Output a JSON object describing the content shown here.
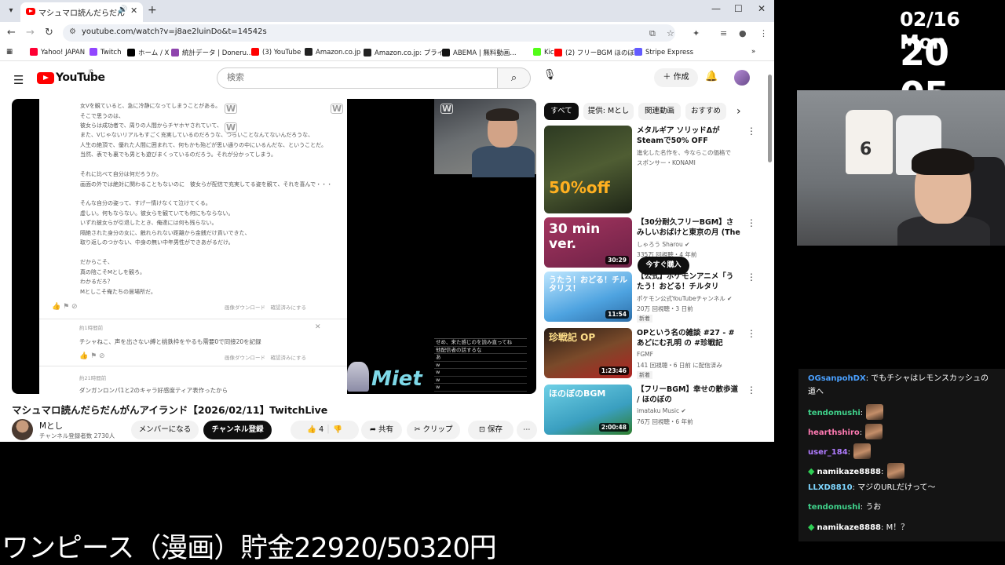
{
  "browser": {
    "tab_title": "マシュマロ読んだらだんがんアイ",
    "url": "youtube.com/watch?v=j8ae2luinDo&t=14542s",
    "bookmarks": [
      {
        "label": "Yahoo! JAPAN",
        "color": "#ff0033"
      },
      {
        "label": "Twitch",
        "color": "#9146ff"
      },
      {
        "label": "ホーム / X",
        "color": "#000000"
      },
      {
        "label": "統計データ | Doneru...",
        "color": "#8e44ad"
      },
      {
        "label": "(3) YouTube",
        "color": "#ff0000"
      },
      {
        "label": "Amazon.co.jp",
        "color": "#222222"
      },
      {
        "label": "Amazon.co.jp: プライ...",
        "color": "#222222"
      },
      {
        "label": "ABEMA | 無料動画...",
        "color": "#111111"
      },
      {
        "label": "Kick",
        "color": "#53fc18"
      },
      {
        "label": "(2) フリーBGM ほのぼ...",
        "color": "#ff0000"
      },
      {
        "label": "Stripe Express",
        "color": "#635bff"
      }
    ]
  },
  "youtube": {
    "logo_text": "YouTube",
    "region": "JP",
    "search_placeholder": "検索",
    "create_label": "作成",
    "video": {
      "title": "マシュマロ読んだらだんがんアイランド【2026/02/11】TwitchLive",
      "channel": "Mとし",
      "subscribers": "チャンネル登録者数 2730人",
      "member_label": "メンバーになる",
      "subscribe_label": "チャンネル登録",
      "likes": "4",
      "share_label": "共有",
      "clip_label": "クリップ",
      "save_label": "保存"
    },
    "player_doc": {
      "lines": [
        "女Vを観ていると、急に冷静になってしまうことがある。",
        "そこで思うのは、",
        "彼女らは成功者で、周りの人間からチヤホヤされていて、",
        "また、Vじゃないリアルもすごく充実しているのだろうな、つらいことなんてないんだろうな、",
        "人生の絶頂で、優れた人間に囲まれて、何もかも殆どが思い通りの中にいるんだな、ということだ。",
        "当然、表でも裏でも男とも遊びまくっているのだろう。それが分かってしまう。",
        "",
        "それに比べて自分は何だろうか。",
        "画面の外では絶対に関わることもないのに　彼女らが配信で充実してる姿を観て、それを喜んで・・・",
        "",
        "そんな自分の姿って、すげー情けなくて泣けてくる。",
        "虚しい。何もならない。彼女らを観ていても何にもならない。",
        "いずれ彼女らが引退したとき、俺達には何も残らない。",
        "隔絶された身分の女に、触れられない距離から金銭だけ貢いできた、",
        "取り返しのつかない、中身の無い中年男性ができあがるだけ。",
        "",
        "だからこそ、",
        "真の陰こそMとしを観ろ。",
        "わかるだろ？",
        "Mとしこそ俺たちの居場所だ。"
      ],
      "actions_1": "画像ダウンロード　確認済みにする",
      "time_2": "約1時間前",
      "msg_2": "チシャねこ、声を出さない縛と桃鉄枠をやるも需要0で同接20を記録",
      "actions_2": "画像ダウンロード　確認済みにする",
      "time_3": "約21時間前",
      "msg_3": "ダンガンロンパ1と2のキャラ好感度ティア表作ったから",
      "chat_lines": [
        "せめ、来た感じのを読み直ってね",
        "他配信者の話するな",
        "あ",
        "w",
        "w",
        "w",
        "w"
      ],
      "overlay_brand": "Miet"
    },
    "chips": [
      "すべて",
      "提供: Mとし",
      "関連動画",
      "おすすめ"
    ],
    "recommendations": [
      {
        "title": "メタルギア ソリッドΔがSteamで50% OFF",
        "channel": "進化した名作を、今ならこの価格で",
        "meta": "スポンサー・KONAMI",
        "duration": "",
        "new": "",
        "buy_label": "今すぐ購入",
        "thumb_text": "50%off"
      },
      {
        "title": "【30分耐久フリーBGM】さみしいおばけと東京の月 (The lonely...",
        "channel": "しゃろう Sharou ✔",
        "meta": "335万 回視聴・4 年前",
        "duration": "30:29",
        "new": "",
        "thumb_text": "30 min ver."
      },
      {
        "title": "【公式】ポケモンアニメ「うたう！おどる！チルタリス！」...",
        "channel": "ポケモン公式YouTubeチャンネル ✔",
        "meta": "20万 回視聴・3 日前",
        "duration": "11:54",
        "new": "新着",
        "thumb_text": "うたう！おどる！チルタリス！"
      },
      {
        "title": "OPという名の雑談 #27 - #あどにむ孔明 の #珍戦記",
        "channel": "FGMF",
        "meta": "141 回視聴・6 日前 に配信済み",
        "duration": "1:23:46",
        "new": "新着",
        "thumb_text": "珍戦記 OP"
      },
      {
        "title": "【フリーBGM】幸せの散歩道 / ほのぼの",
        "channel": "imataku Music ✔",
        "meta": "76万 回視聴・6 年前",
        "duration": "2:00:48",
        "new": "",
        "thumb_text": "ほのぼのBGM"
      }
    ]
  },
  "overlay": {
    "date": "02/16 Mon",
    "time": "20 05",
    "savings": "ワンピース（漫画）貯金22920/50320円",
    "chat": [
      {
        "user": "OGsanpohDX",
        "color": "#4aa0ff",
        "text": "でもチシャはレモンスカッシュの",
        "cont": "道へ",
        "emote": false,
        "badge": false
      },
      {
        "user": "tendomushi",
        "color": "#3fd18a",
        "text": "",
        "emote": true,
        "badge": false
      },
      {
        "user": "hearthshiro",
        "color": "#ff7ab2",
        "text": "",
        "emote": true,
        "badge": false
      },
      {
        "user": "user_184",
        "color": "#b07cff",
        "text": "",
        "emote": true,
        "badge": false
      },
      {
        "user": "namikaze8888",
        "color": "#ffffff",
        "text": "",
        "emote": true,
        "badge": true
      },
      {
        "user": "LLXD8810",
        "color": "#7ed6ff",
        "text": "マジのURLだけって〜",
        "emote": false,
        "badge": false
      },
      {
        "user": "tendomushi",
        "color": "#3fd18a",
        "text": "うお",
        "emote": false,
        "badge": false
      },
      {
        "user": "namikaze8888",
        "color": "#ffffff",
        "text": "M！？",
        "emote": false,
        "badge": true
      }
    ]
  }
}
